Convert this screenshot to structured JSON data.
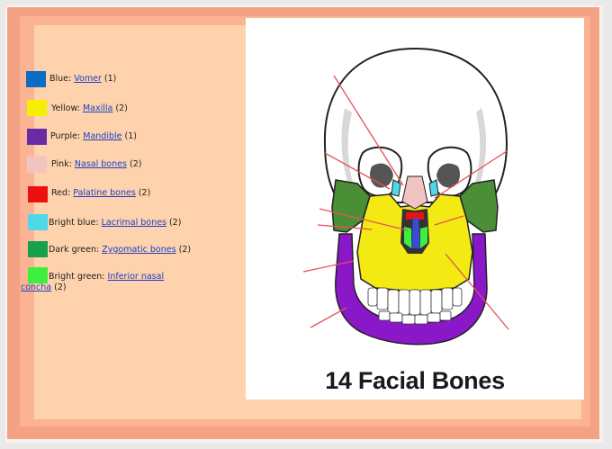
{
  "legend": [
    {
      "color_name": "Blue",
      "bone": "Vomer",
      "count": "(1)",
      "hex": "#0b6cc4"
    },
    {
      "color_name": "Yellow",
      "bone": "Maxilla",
      "count": "(2)",
      "hex": "#f4f000"
    },
    {
      "color_name": "Purple",
      "bone": "Mandible",
      "count": "(1)",
      "hex": "#6a2aa5"
    },
    {
      "color_name": "Pink",
      "bone": "Nasal bones",
      "count": "(2)",
      "hex": "#f0c4c0"
    },
    {
      "color_name": "Red",
      "bone": "Palatine bones",
      "count": "(2)",
      "hex": "#ee1010"
    },
    {
      "color_name": "Bright blue",
      "bone": "Lacrimal bones",
      "count": "(2)",
      "hex": "#4fd8e8"
    },
    {
      "color_name": "Dark green",
      "bone": "Zygomatic bones",
      "count": "(2)",
      "hex": "#17a14a"
    },
    {
      "color_name": "Bright green",
      "bone": "Inferior nasal concha",
      "bone_line1": "Inferior nasal",
      "bone_line2": "concha",
      "count": "(2)",
      "hex": "#3ef03e"
    }
  ],
  "figure": {
    "title": "14 Facial Bones"
  },
  "colors": {
    "frame_coral": "#f4a184",
    "panel_peach": "#fdd2ac",
    "mandible_purple": "#8a18c8",
    "maxilla_yellow": "#f2ea12",
    "zygomatic_green": "#4a8f36",
    "pointer_red": "#e8505a"
  }
}
